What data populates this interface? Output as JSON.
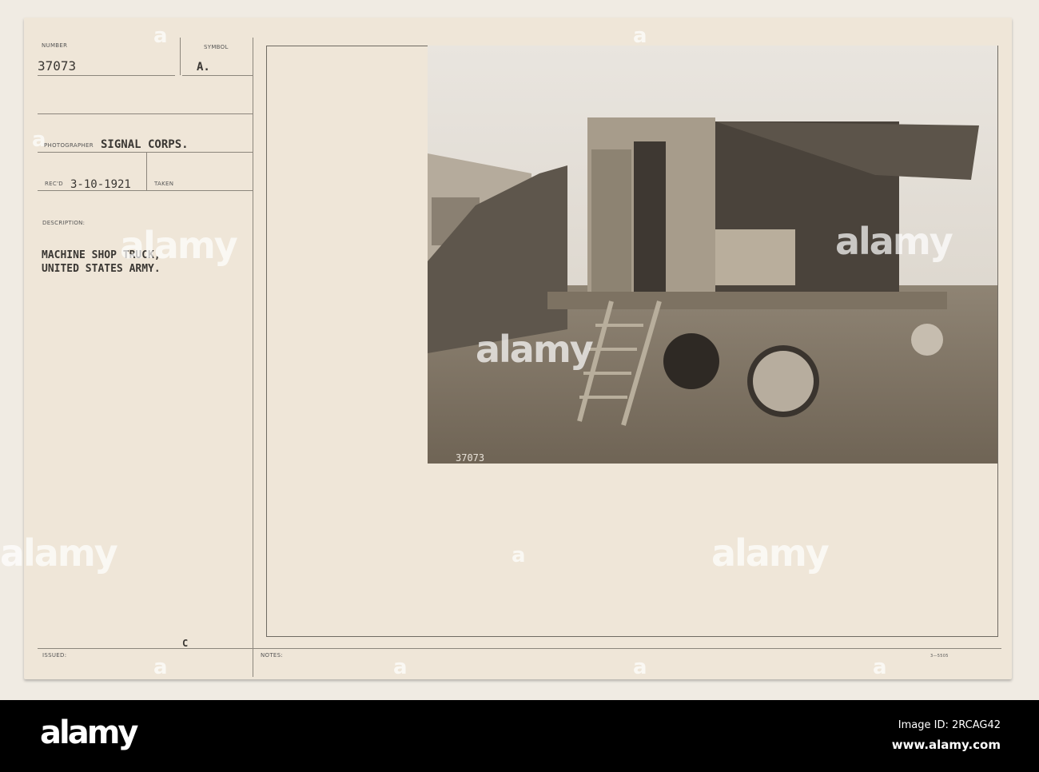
{
  "card": {
    "number_label": "NUMBER",
    "number_value": "37073",
    "symbol_label": "SYMBOL",
    "symbol_value": "A.",
    "photographer_label": "PHOTOGRAPHER",
    "photographer_value": "SIGNAL CORPS.",
    "recd_label": "REC'D",
    "recd_value": "3-10-1921",
    "taken_label": "TAKEN",
    "description_label": "DESCRIPTION:",
    "description_lines": [
      "MACHINE SHOP TRUCK,",
      "UNITED STATES ARMY."
    ],
    "issued_label": "ISSUED:",
    "issued_mark": "C",
    "notes_label": "NOTES:",
    "form_number": "3—5505"
  },
  "photo": {
    "inscription": "37073"
  },
  "watermark": {
    "text": "alamy",
    "small": "a"
  },
  "footer": {
    "logo": "alamy",
    "image_id": "Image ID: 2RCAG42",
    "url": "www.alamy.com"
  },
  "colors": {
    "card": "#efe6d8",
    "ink": "#3a3733",
    "footer": "#000000"
  }
}
